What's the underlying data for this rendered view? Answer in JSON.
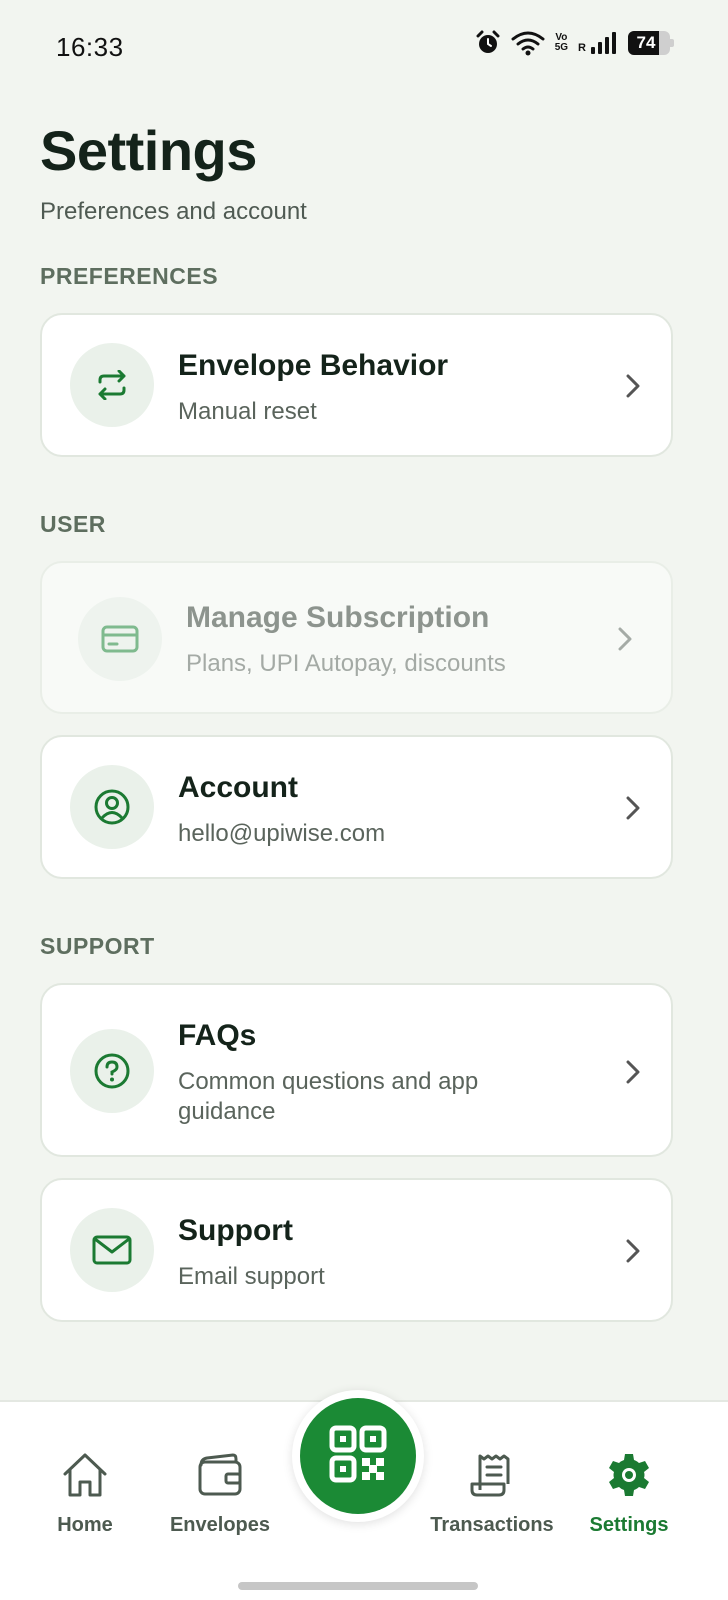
{
  "status_bar": {
    "time": "16:33",
    "volte_top": "Vo",
    "volte_bottom": "5G",
    "roaming": "R",
    "battery_level": "74",
    "battery_fraction": 0.74
  },
  "header": {
    "title": "Settings",
    "subtitle": "Preferences and account"
  },
  "sections": {
    "preferences": "PREFERENCES",
    "user": "USER",
    "support": "SUPPORT"
  },
  "items": {
    "envelope_behavior": {
      "title": "Envelope Behavior",
      "subtitle": "Manual reset",
      "icon": "repeat-icon"
    },
    "manage_subscription": {
      "title": "Manage Subscription",
      "subtitle": "Plans, UPI Autopay, discounts",
      "icon": "credit-card-icon",
      "state": "disabled"
    },
    "account": {
      "title": "Account",
      "subtitle": "hello@upiwise.com",
      "icon": "user-circle-icon"
    },
    "faqs": {
      "title": "FAQs",
      "subtitle": "Common questions and app guidance",
      "icon": "question-circle-icon"
    },
    "support": {
      "title": "Support",
      "subtitle": "Email support",
      "icon": "mail-icon"
    }
  },
  "nav": {
    "home": "Home",
    "envelopes": "Envelopes",
    "transactions": "Transactions",
    "settings": "Settings",
    "active": "settings"
  },
  "colors": {
    "brand_green": "#1b8a35",
    "active_nav": "#1b7a32",
    "background": "#f2f5f0"
  }
}
